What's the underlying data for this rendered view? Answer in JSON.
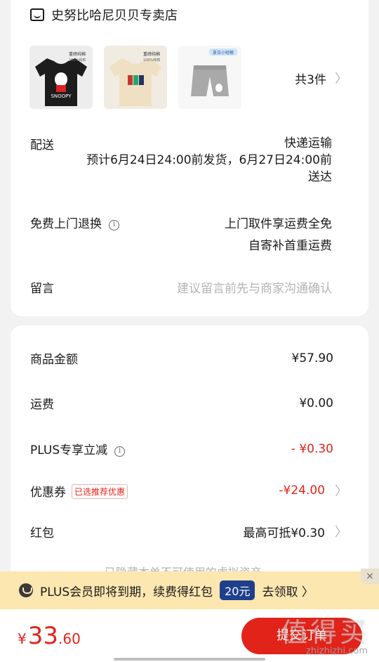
{
  "store": {
    "name": "史努比哈尼贝贝专卖店"
  },
  "products": {
    "thumbs": [
      {
        "icon": "black-tshirt-image",
        "caption": "重磅纯棉",
        "sub": "100%纯棉",
        "print": "SNOOPY"
      },
      {
        "icon": "cream-tshirt-image",
        "caption": "重磅纯棉",
        "sub": "100%纯棉"
      },
      {
        "icon": "gray-shorts-image",
        "caption": "夏日小短裤"
      }
    ],
    "count_label": "共3件"
  },
  "delivery": {
    "label": "配送",
    "method": "快递运输",
    "estimate_line1": "预计6月24日24:00前发货，6月27日24:00前",
    "estimate_line2": "送达"
  },
  "returns": {
    "label": "免费上门退换",
    "line1": "上门取件享运费全免",
    "line2": "自寄补首重运费"
  },
  "message": {
    "label": "留言",
    "placeholder": "建议留言前先与商家沟通确认"
  },
  "pricing": {
    "goods_label": "商品金额",
    "goods_value": "¥57.90",
    "shipping_label": "运费",
    "shipping_value": "¥0.00",
    "plus_label": "PLUS专享立减",
    "plus_value": "- ¥0.30",
    "coupon_label": "优惠券",
    "coupon_tag": "已选推荐优惠",
    "coupon_value": "-¥24.00",
    "redpacket_label": "红包",
    "redpacket_value": "最高可抵¥0.30",
    "hidden_note": "已隐藏本单不可使用的虚拟资产 ⌄"
  },
  "banner": {
    "text": "PLUS会员即将到期，续费得红包",
    "badge": "20元",
    "action": "去领取 〉",
    "close": "×"
  },
  "footer": {
    "currency": "¥",
    "total_int": "33",
    "total_dec": ".60",
    "submit_label": "提交订单",
    "watermark_big": "值得买",
    "watermark_small": "zhizhizhi.com"
  },
  "colors": {
    "accent_red": "#e2231a",
    "banner_bg": "#fce7b0",
    "badge_blue": "#1e3f8c"
  }
}
